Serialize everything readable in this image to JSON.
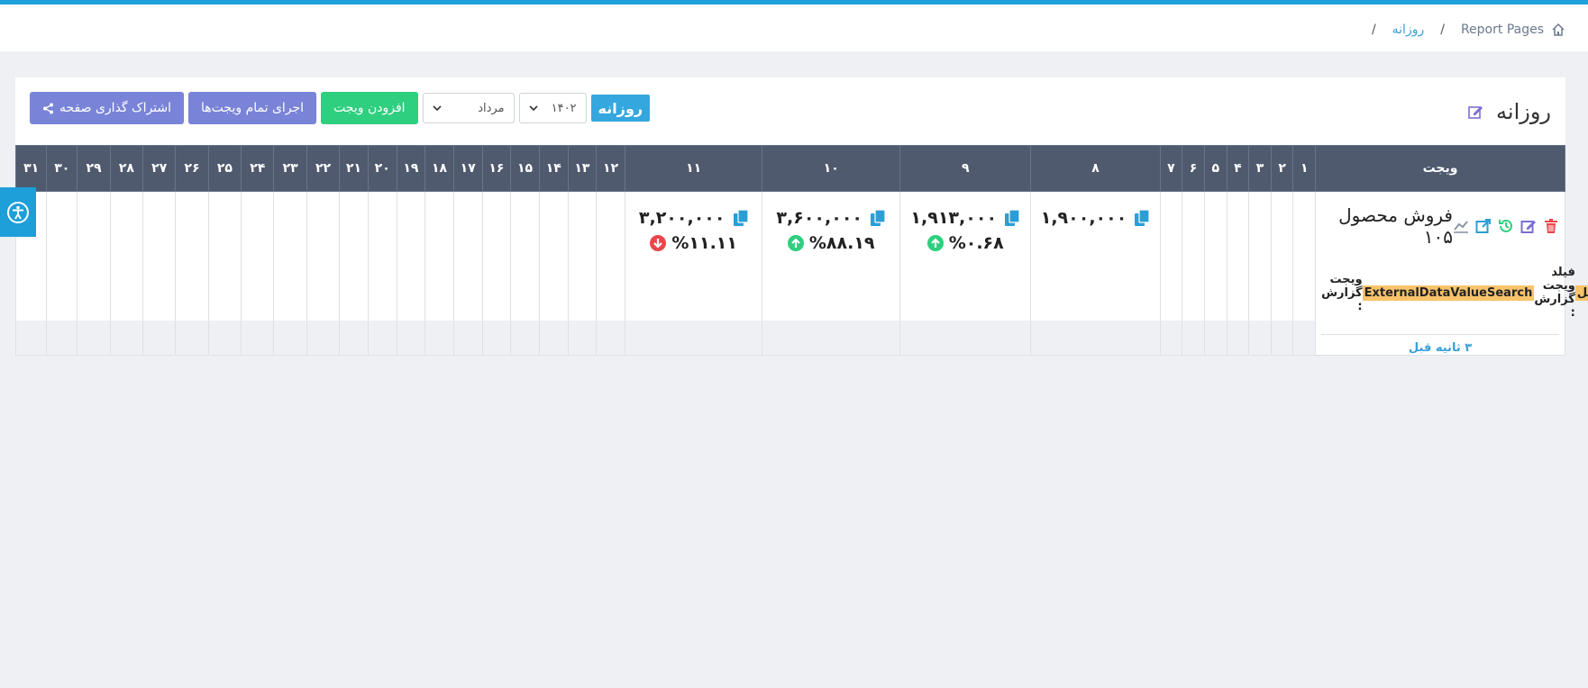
{
  "breadcrumb": {
    "root": "Report Pages",
    "separator": "/",
    "current": "روزانه",
    "trailing_sep": "/"
  },
  "page": {
    "title": "روزانه"
  },
  "toolbar": {
    "period_badge": "روزانه",
    "year_value": "۱۴۰۲",
    "month_value": "مرداد",
    "add_widget": "افزودن ویجت",
    "run_all": "اجرای تمام ویجت‌ها",
    "share_page": "اشتراک گذاری صفحه"
  },
  "table": {
    "widget_header": "ویجت",
    "days": [
      "۱",
      "۲",
      "۳",
      "۴",
      "۵",
      "۶",
      "۷",
      "۸",
      "۹",
      "۱۰",
      "۱۱",
      "۱۲",
      "۱۳",
      "۱۴",
      "۱۵",
      "۱۶",
      "۱۷",
      "۱۸",
      "۱۹",
      "۲۰",
      "۲۱",
      "۲۲",
      "۲۳",
      "۲۴",
      "۲۵",
      "۲۶",
      "۲۷",
      "۲۸",
      "۲۹",
      "۳۰",
      "۳۱"
    ]
  },
  "widget": {
    "name": "فروش محصول ۱۰۵",
    "report_label": "ویجت گزارش :",
    "report_value": "ExternalDataValueSearch",
    "field_label": "فیلد ویجت گزارش :",
    "field_value": "جمع‌کل",
    "time_ago": "۳ ثانیه قبل"
  },
  "values": {
    "day8": {
      "value": "۱,۹۰۰,۰۰۰"
    },
    "day9": {
      "value": "۱,۹۱۳,۰۰۰",
      "pct": "%۰.۶۸",
      "direction": "up"
    },
    "day10": {
      "value": "۳,۶۰۰,۰۰۰",
      "pct": "%۸۸.۱۹",
      "direction": "up"
    },
    "day11": {
      "value": "۳,۲۰۰,۰۰۰",
      "pct": "%۱۱.۱۱",
      "direction": "down"
    }
  },
  "colors": {
    "accent": "#1ea1dd",
    "header_bg": "#4f5a6f",
    "green": "#2ecf7f",
    "purple": "#7983d8",
    "red": "#e9474b",
    "highlight": "#f9c36a"
  }
}
